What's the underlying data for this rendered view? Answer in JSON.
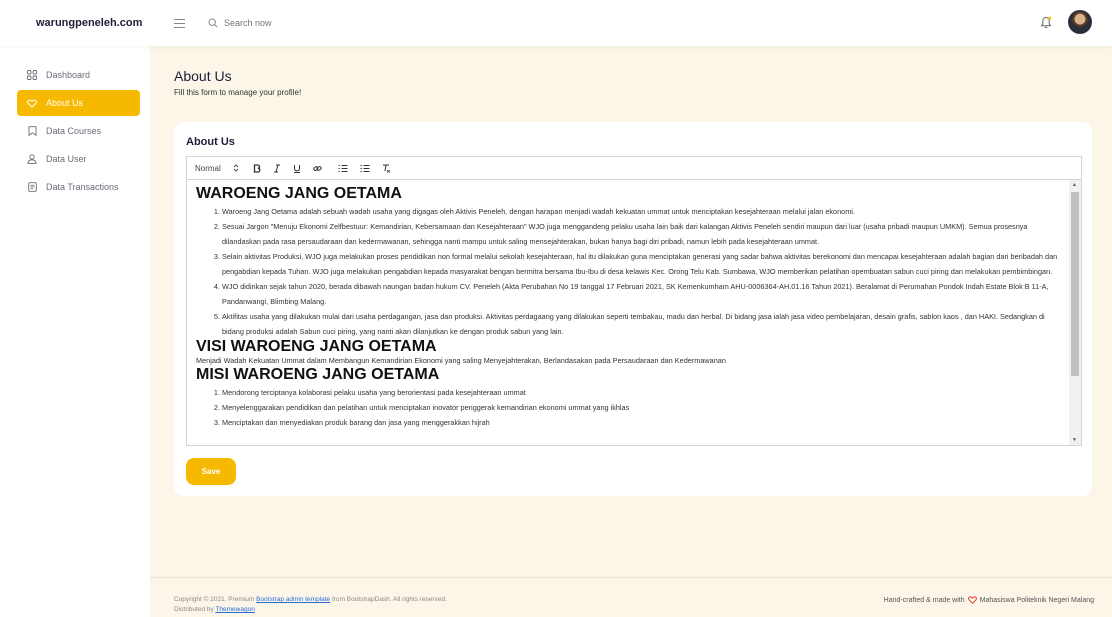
{
  "brand": "warungpeneleh.com",
  "search": {
    "placeholder": "Search now"
  },
  "sidebar": {
    "items": [
      {
        "label": "Dashboard",
        "icon": "grid-icon"
      },
      {
        "label": "About Us",
        "icon": "heart-icon",
        "active": true
      },
      {
        "label": "Data Courses",
        "icon": "bookmark-icon"
      },
      {
        "label": "Data User",
        "icon": "user-icon"
      },
      {
        "label": "Data Transactions",
        "icon": "receipt-icon"
      }
    ]
  },
  "page": {
    "title": "About Us",
    "subtitle": "Fill this form to manage your profile!"
  },
  "card": {
    "title": "About Us",
    "save_label": "Save"
  },
  "toolbar": {
    "heading_select": "Normal",
    "buttons": [
      "bold",
      "italic",
      "underline",
      "link",
      "ordered-list",
      "bullet-list",
      "clear-format"
    ]
  },
  "editor": {
    "heading1": "WAROENG JANG OETAMA",
    "list1": [
      "Waroeng Jang Oetama adalah sebuah wadah usaha yang digagas oleh Aktivis Peneleh, dengan harapan menjadi wadah kekuatan ummat untuk menciptakan kesejahteraan melalui jalan ekonomi.",
      "Sesuai Jargon \"Menuju Ekonomi Zelfbestuur: Kemandirian, Kebersamaan dan Kesejahteraan\" WJO juga menggandeng pelaku usaha lain baik dari kalangan Aktivis Peneleh sendiri maupun dari luar (usaha pribadi maupun UMKM). Semua prosesnya dilandaskan pada rasa persaudaraan dan kedermawanan, sehingga nanti mampu untuk saling mensejahterakan, bukan hanya bagi diri pribadi, namun lebih pada kesejahteraan ummat.",
      "Selain aktivitas Produksi, WJO juga melakukan proses pendidikan non formal melalui sekolah kesejahteraan, hal itu dilakukan guna menciptakan generasi yang sadar bahwa aktivitas berekonomi dan mencapai kesejahteraan adalah bagian dari beribadah dan pengabdian kepada Tuhan. WJO juga melakukan pengabdian kepada masyarakat bengan bermitra bersama Ibu-Ibu di desa kelawis Kec. Orong Telu Kab. Sumbawa, WJO memberikan pelatihan opembuatan sabun cuci piring dan melakukan pembimbingan.",
      "WJO didirikan sejak tahun 2020, berada dibawah naungan badan hukum CV. Peneleh (Akta Perubahan No 19 tanggal 17 Februari 2021, SK Kemenkumham AHU-0006364-AH.01.16 Tahun 2021). Beralamat di Perumahan Pondok Indah Estate Blok B 11-A, Pandanwangi, Blimbing Malang.",
      "Aktifitas usaha yang dilakukan mulai dari usaha perdagangan, jasa dan produksi. Aktivitas perdagaang yang dilakukan seperti tembakau, madu dan herbal. Di bidang jasa ialah jasa video pembelajaran, desain grafis, sablon kaos , dan HAKI. Sedangkan di bidang produksi adalah Sabun cuci piring, yang nanti akan dilanjutkan ke dengan produk sabun yang lain."
    ],
    "heading2": "VISI WAROENG JANG OETAMA",
    "visi": "Menjadi Wadah Kekuatan Ummat dalam Membangun Kemandirian Ekonomi yang saling Menyejahterakan, Berlandasakan pada Persaudaraan dan Kedermawanan",
    "heading3": "MISI WAROENG JANG OETAMA",
    "list2": [
      "Mendorong terciptanya kolaborasi pelaku usaha yang berorientasi pada kesejahteraan ummat",
      "Menyelenggarakan pendidikan dan pelatihan untuk menciptakan inovator penggerak kemandirian ekonomi ummat yang ikhlas",
      "Menciptakan dan menyediakan produk barang dan jasa yang menggerakkan hijrah"
    ]
  },
  "footer": {
    "copyright_prefix": "Copyright © 2021. Premium ",
    "link1": "Bootstrap admin template",
    "copyright_suffix": " from BootstrapDash. All rights reserved.",
    "distributed_prefix": "Distributed by ",
    "link2": "Themewagon",
    "right_prefix": "Hand-crafted & made with",
    "right_suffix": "Mahasiswa Politeknik Negeri Malang"
  },
  "colors": {
    "accent": "#f6b900",
    "content_bg": "#fbf6e8",
    "heart": "#e53935"
  }
}
